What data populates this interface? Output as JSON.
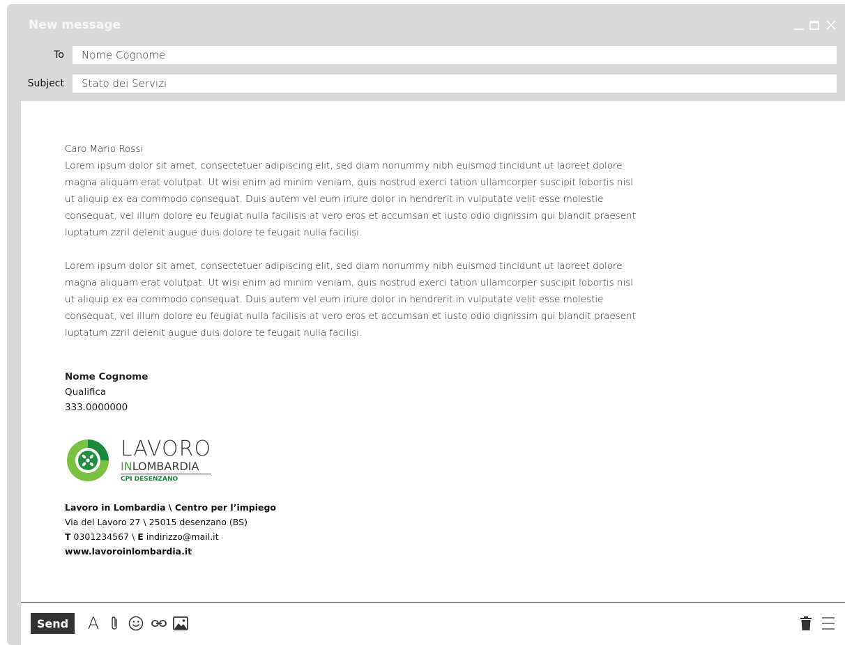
{
  "window": {
    "title": "New message",
    "controls": [
      "minimize-icon",
      "maximize-icon",
      "close-icon"
    ]
  },
  "fields": {
    "to_label": "To",
    "to_value": "Nome Cognome",
    "subject_label": "Subject",
    "subject_value": "Stato dei Servizi"
  },
  "message": {
    "greeting": "Caro Mario Rossi",
    "paragraphs": [
      "Lorem ipsum dolor sit amet, consectetuer adipiscing elit, sed diam nonummy nibh euismod tincidunt ut laoreet dolore magna aliquam erat volutpat. Ut wisi enim ad minim veniam, quis nostrud exerci tation ullamcorper suscipit lobortis nisl ut aliquip ex ea commodo consequat. Duis autem vel eum iriure dolor in hendrerit in vulputate velit esse molestie consequat, vel illum dolore eu feugiat nulla facilisis at vero eros et accumsan et iusto odio dignissim qui blandit praesent luptatum zzril delenit augue duis dolore te feugait nulla facilisi.",
      "Lorem ipsum dolor sit amet, consectetuer adipiscing elit, sed diam nonummy nibh euismod tincidunt ut laoreet dolore magna aliquam erat volutpat. Ut wisi enim ad minim veniam, quis nostrud exerci tation ullamcorper suscipit lobortis nisl ut aliquip ex ea commodo consequat. Duis autem vel eum iriure dolor in hendrerit in vulputate velit esse molestie consequat, vel illum dolore eu feugiat nulla facilisis at vero eros et accumsan et iusto odio dignissim qui blandit praesent luptatum zzril delenit augue duis dolore te feugait nulla facilisi."
    ]
  },
  "signature": {
    "name": "Nome Cognome",
    "role": "Qualifica",
    "phone": "333.0000000"
  },
  "logo": {
    "main": "LAVORO",
    "sub_in": "IN",
    "sub_rest": "LOMBARDIA",
    "cpi": "CPI DESENZANO",
    "colors": {
      "green": "#4aa141",
      "dark_green": "#1a8a3a"
    }
  },
  "org": {
    "name": "Lavoro in Lombardia \\ Centro per l’impiego",
    "address": "Via del Lavoro 27 \\ 25015 desenzano (BS)",
    "t_label": "T",
    "t_value": " 0301234567 \\ ",
    "e_label": "E",
    "e_value": " indirizzo@mail.it",
    "website": "www.lavoroinlombardia.it"
  },
  "toolbar": {
    "send_label": "Send",
    "font_glyph": "A",
    "tools": [
      "font-icon",
      "paperclip-icon",
      "emoji-icon",
      "link-icon",
      "image-icon"
    ],
    "right_tools": [
      "trash-icon",
      "menu-icon"
    ]
  }
}
